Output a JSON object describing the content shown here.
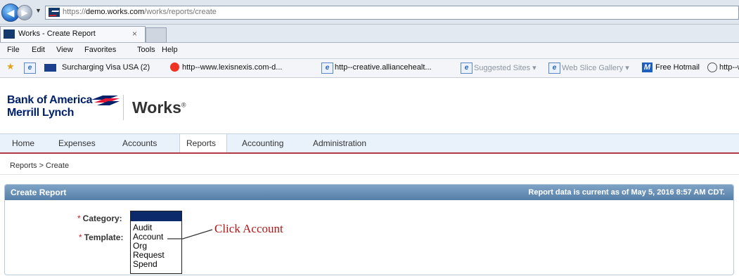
{
  "browser": {
    "url_scheme": "https://",
    "url_host": "demo.works.com",
    "url_path": "/works/reports/create",
    "tab_title": "Works - Create Report",
    "tab_close": "×",
    "menu": [
      "File",
      "Edit",
      "View",
      "Favorites",
      "Tools",
      "Help"
    ],
    "favorites": [
      {
        "label": "Surcharging Visa USA (2)",
        "dim": false
      },
      {
        "label": "http--www.lexisnexis.com-d...",
        "dim": false
      },
      {
        "label": "http--creative.alliancehealt...",
        "dim": false
      },
      {
        "label": "Suggested Sites ▾",
        "dim": true
      },
      {
        "label": "Web Slice Gallery ▾",
        "dim": true
      },
      {
        "label": "Free Hotmail",
        "dim": false
      },
      {
        "label": "http--www.doa.l",
        "dim": false
      }
    ]
  },
  "brand": {
    "line1": "Bank of America",
    "line2": "Merrill Lynch",
    "product": "Works",
    "product_mark": "®"
  },
  "nav": {
    "items": [
      "Home",
      "Expenses",
      "Accounts",
      "Reports",
      "Accounting",
      "Administration"
    ],
    "active": "Reports"
  },
  "breadcrumb": "Reports > Create",
  "panel": {
    "title": "Create Report",
    "note": "Report data is current as of May 5, 2016 8:57 AM CDT."
  },
  "form": {
    "required_mark": "*",
    "category_label": "Category:",
    "template_label": "Template:",
    "category_options": [
      "Audit",
      "Account",
      "Org",
      "Request",
      "Spend"
    ]
  },
  "annotation": {
    "text": "Click Account",
    "color": "#b01818"
  }
}
